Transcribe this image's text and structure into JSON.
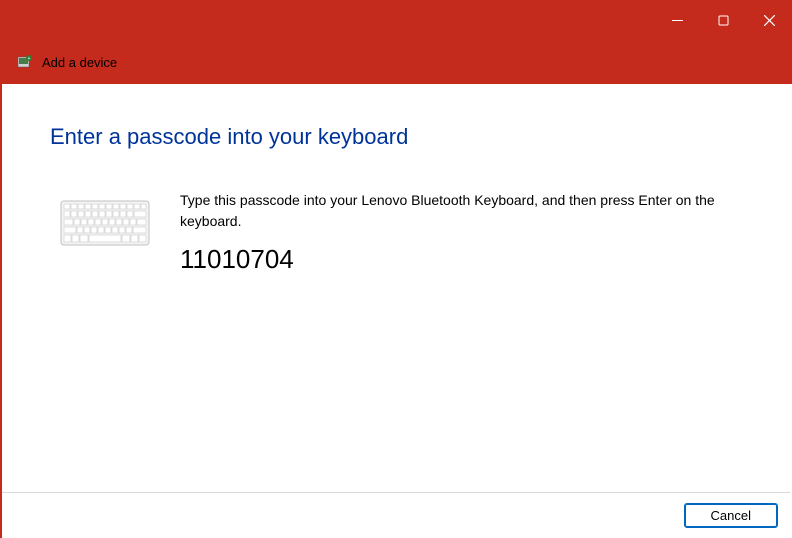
{
  "titlebar": {
    "title": "Add a device"
  },
  "content": {
    "heading": "Enter a passcode into your keyboard",
    "instruction": "Type this passcode into your Lenovo Bluetooth Keyboard, and then press Enter on the keyboard.",
    "passcode": "11010704"
  },
  "footer": {
    "cancel_label": "Cancel"
  }
}
